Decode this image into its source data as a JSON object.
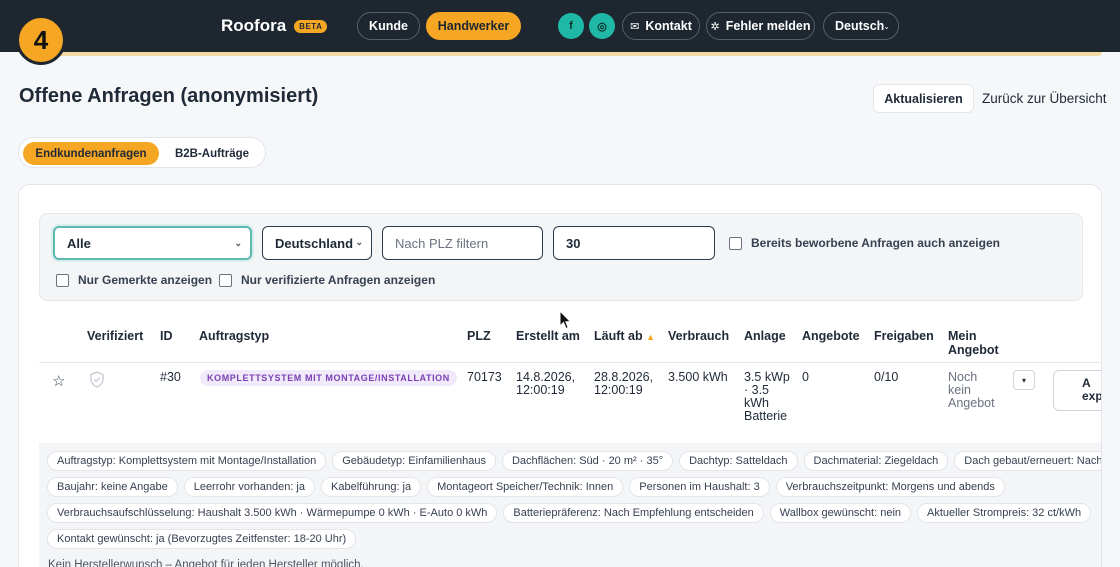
{
  "header": {
    "brand": "Roofora",
    "beta": "BETA",
    "nav": [
      "Kunde",
      "Handwerker"
    ],
    "social": [
      "f",
      "◎"
    ],
    "contact": "Kontakt",
    "report_bug": "Fehler melden",
    "language": "Deutsch"
  },
  "step_badge": "4",
  "page": {
    "title": "Offene Anfragen (anonymisiert)",
    "refresh": "Aktualisieren",
    "back": "Zurück zur Übersicht"
  },
  "tabs": [
    "Endkundenanfragen",
    "B2B-Aufträge"
  ],
  "filters": {
    "type_select": "Alle",
    "country_select": "Deutschland",
    "plz_placeholder": "Nach PLZ filtern",
    "radius": "30",
    "show_applied": "Bereits beworbene Anfragen auch anzeigen",
    "only_marked": "Nur Gemerkte anzeigen",
    "only_verified": "Nur verifizierte Anfragen anzeigen"
  },
  "table": {
    "headers": [
      "Verifiziert",
      "ID",
      "Auftragstyp",
      "PLZ",
      "Erstellt am",
      "Läuft ab",
      "Verbrauch",
      "Anlage",
      "Angebote",
      "Freigaben",
      "Mein Angebot"
    ],
    "sort_indicator": "▲",
    "row": {
      "id": "#30",
      "type": "KOMPLETTSYSTEM MIT MONTAGE/INSTALLATION",
      "plz": "70173",
      "created": "14.8.2026, 12:00:19",
      "expires": "28.8.2026, 12:00:19",
      "consumption": "3.500 kWh",
      "system": "3.5 kWp · 3.5 kWh Batterie",
      "offers": "0",
      "releases": "0/10",
      "my_offer": "Noch kein Angebot",
      "menu": "▾",
      "action": "A exp"
    }
  },
  "details": {
    "chips": [
      [
        "Auftragstyp: Komplettsystem mit Montage/Installation",
        "Gebäudetyp: Einfamilienhaus",
        "Dachflächen: Süd · 20 m² · 35°",
        "Dachtyp: Satteldach",
        "Dachmaterial: Ziegeldach",
        "Dach gebaut/erneuert: Nach"
      ],
      [
        "Baujahr: keine Angabe",
        "Leerrohr vorhanden: ja",
        "Kabelführung: ja",
        "Montageort Speicher/Technik: Innen",
        "Personen im Haushalt: 3",
        "Verbrauchszeitpunkt: Morgens und abends"
      ],
      [
        "Verbrauchsaufschlüsselung: Haushalt 3.500 kWh · Wärmepumpe 0 kWh · E-Auto 0 kWh",
        "Batteriepräferenz: Nach Empfehlung entscheiden",
        "Wallbox gewünscht: nein",
        "Aktueller Strompreis: 32 ct/kWh"
      ],
      [
        "Kontakt gewünscht: ja (Bevorzugtes Zeitfenster: 18-20 Uhr)"
      ]
    ],
    "note": "Kein Herstellerwunsch – Angebot für jeden Hersteller möglich."
  }
}
